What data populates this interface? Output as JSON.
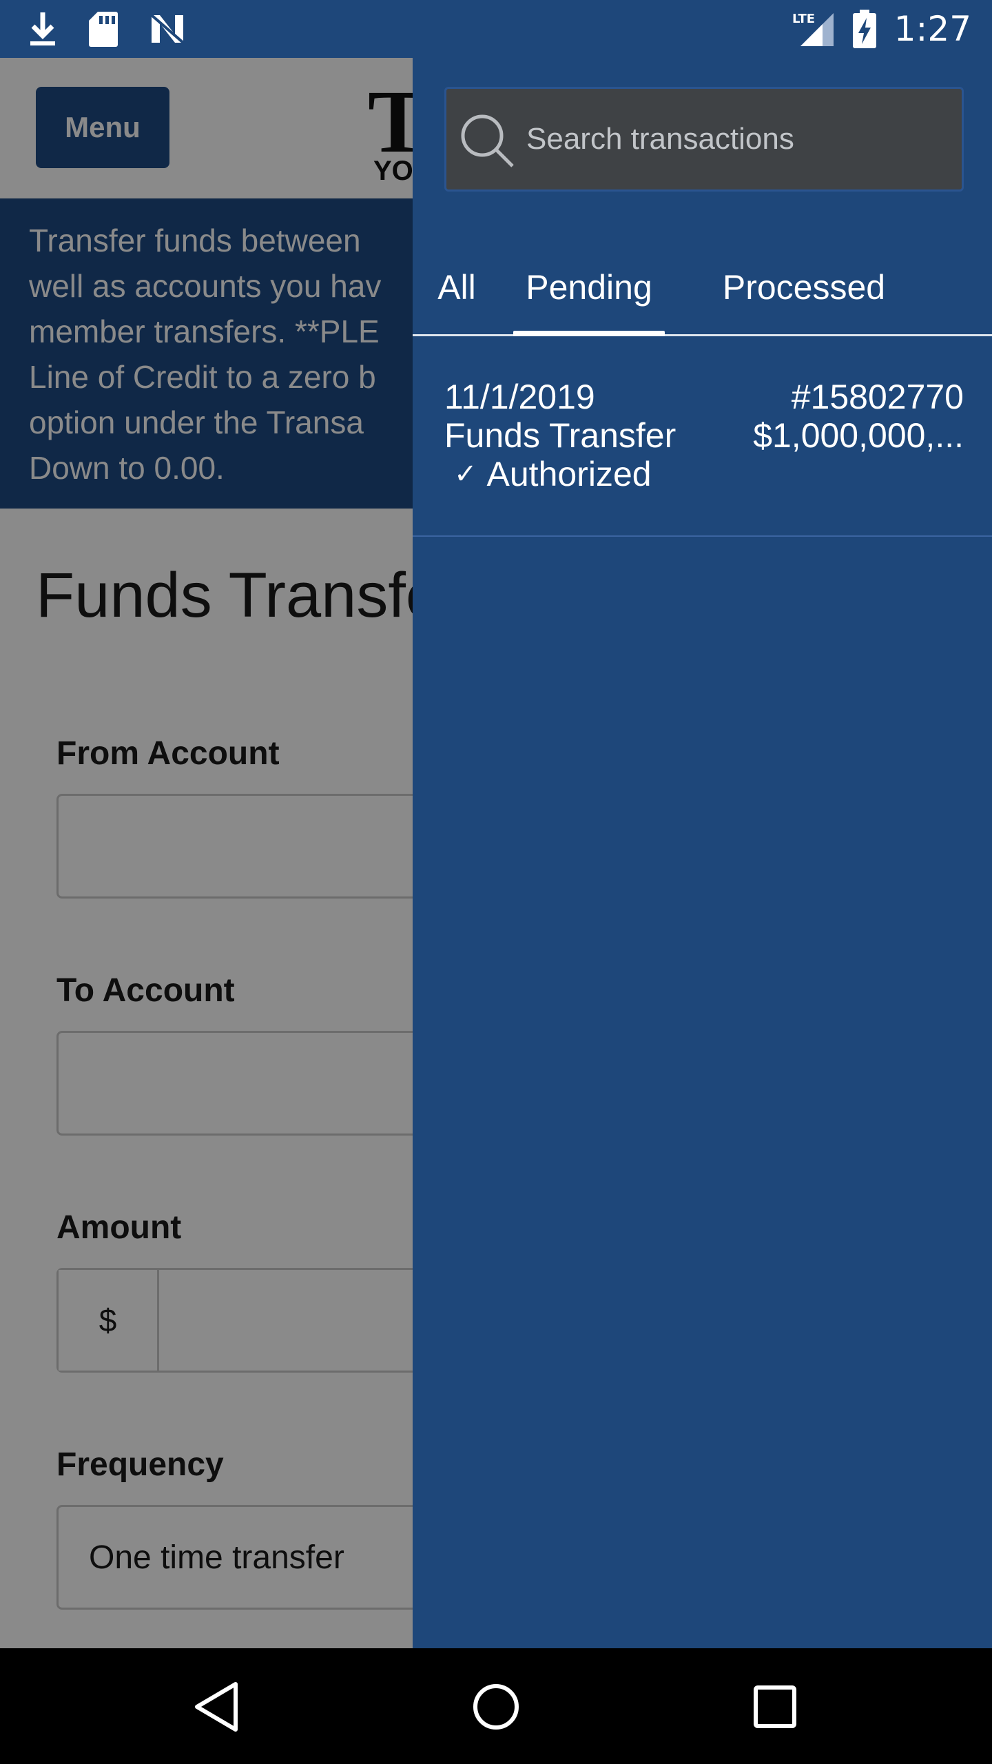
{
  "status_bar": {
    "time": "1:27",
    "network": "LTE",
    "left_icons": [
      "download-icon",
      "sd-card-icon",
      "n-icon"
    ],
    "right_icons": [
      "signal-icon",
      "battery-charging-icon"
    ]
  },
  "page": {
    "menu_label": "Menu",
    "logo_text": "T",
    "logo_subtext": "YOU",
    "notice_lines": [
      "Transfer funds between",
      "well as accounts you hav",
      "member transfers. **PLE",
      "Line of Credit to a zero b",
      "option under the Transa",
      "Down to 0.00."
    ],
    "title": "Funds Transfe",
    "fields": {
      "from_label": "From Account",
      "to_label": "To Account",
      "amount_label": "Amount",
      "amount_prefix": "$",
      "frequency_label": "Frequency",
      "frequency_value": "One time transfer"
    }
  },
  "drawer": {
    "search_placeholder": "Search transactions",
    "tabs": [
      {
        "label": "All"
      },
      {
        "label": "Pending"
      },
      {
        "label": "Processed"
      }
    ],
    "active_tab": "Pending",
    "transactions": [
      {
        "date": "11/1/2019",
        "description": "Funds Transfer",
        "status": "Authorized",
        "reference": "#15802770",
        "amount": "$1,000,000,..."
      }
    ]
  },
  "colors": {
    "drawer_bg": "#1e477a",
    "menu_button": "#1f4b84",
    "search_bg": "#3f4245"
  }
}
